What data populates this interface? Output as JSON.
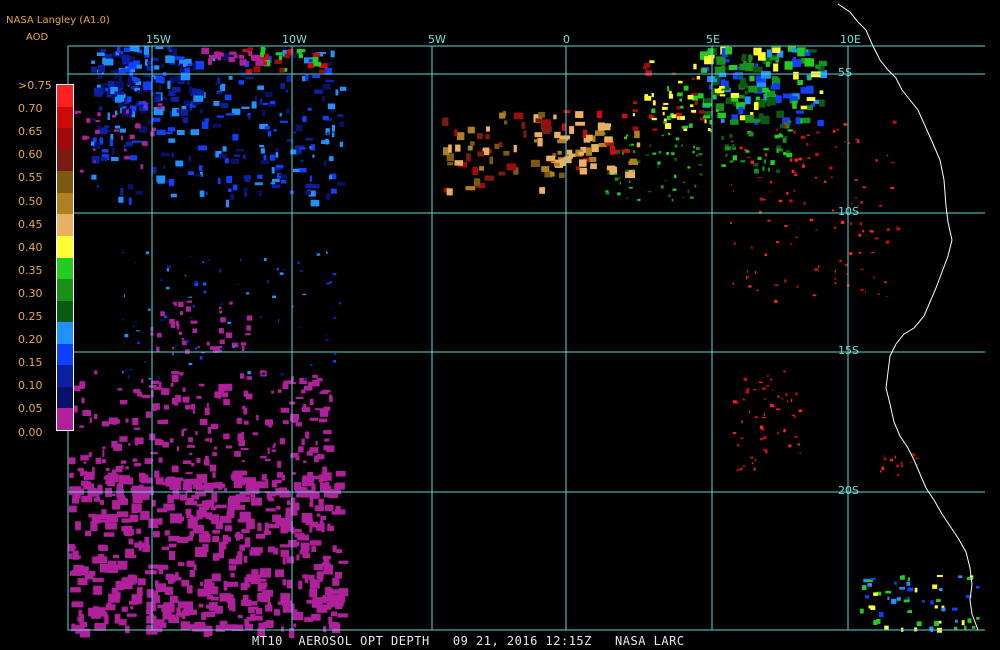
{
  "header": {
    "title": "NASA Langley (A1.0)",
    "subtitle": "AOD"
  },
  "legend": {
    "labels": [
      ">0.75",
      "0.70",
      "0.65",
      "0.60",
      "0.55",
      "0.50",
      "0.45",
      "0.40",
      "0.35",
      "0.30",
      "0.25",
      "0.20",
      "0.15",
      "0.10",
      "0.05",
      "0.00"
    ],
    "colors": [
      "#ff2020",
      "#cc0a0a",
      "#a00a0a",
      "#7a1a10",
      "#7a5a10",
      "#b08020",
      "#e8b060",
      "#ffff30",
      "#22cc22",
      "#18901a",
      "#0c5a10",
      "#1e90ff",
      "#1040ff",
      "#0a20a0",
      "#081068",
      "#b0209a"
    ]
  },
  "graticule": {
    "lon_labels": [
      "15W",
      "10W",
      "5W",
      "0",
      "5E",
      "10E"
    ],
    "lat_labels": [
      "5S",
      "10S",
      "15S",
      "20S"
    ],
    "line_color": "#5ad8d8"
  },
  "footer": {
    "text": "MT10  AEROSOL OPT DEPTH   09 21, 2016 12:15Z   NASA LARC"
  }
}
